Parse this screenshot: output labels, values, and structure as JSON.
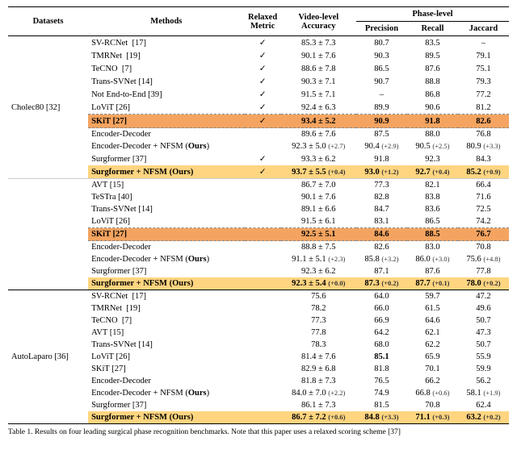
{
  "table": {
    "caption": "Table 1. Results on four leading surgical phase recognition benchmarks. Note that this paper uses a relaxed scoring scheme [37]",
    "col_headers": {
      "datasets": "Datasets",
      "methods": "Methods",
      "relaxed_metric": "Relaxed Metric",
      "video_accuracy": "Video-level Accuracy",
      "phase_precision": "Precision",
      "phase_recall": "Recall",
      "phase_jaccard": "Jaccard",
      "phase_group": "Phase-level"
    },
    "cholec80_rows": [
      {
        "method": "SV-RCNet  [17]",
        "relaxed": true,
        "video_acc": "85.3 ± 7.3",
        "precision": "80.7",
        "recall": "83.5",
        "jaccard": "–"
      },
      {
        "method": "TMRNet  [19]",
        "relaxed": true,
        "video_acc": "90.1 ± 7.6",
        "precision": "90.3",
        "recall": "89.5",
        "jaccard": "79.1"
      },
      {
        "method": "TeCNO  [7]",
        "relaxed": true,
        "video_acc": "88.6 ± 7.8",
        "precision": "86.5",
        "recall": "87.6",
        "jaccard": "75.1"
      },
      {
        "method": "Trans-SVNet [14]",
        "relaxed": true,
        "video_acc": "90.3 ± 7.1",
        "precision": "90.7",
        "recall": "88.8",
        "jaccard": "79.3"
      },
      {
        "method": "Not End-to-End [39]",
        "relaxed": true,
        "video_acc": "91.5 ± 7.1",
        "precision": "–",
        "recall": "86.8",
        "jaccard": "77.2"
      },
      {
        "method": "LoViT [26]",
        "relaxed": true,
        "video_acc": "92.4 ± 6.3",
        "precision": "89.9",
        "recall": "90.6",
        "jaccard": "81.2"
      },
      {
        "method": "SKiT [27]",
        "relaxed": true,
        "video_acc": "93.4 ± 5.2",
        "precision": "90.9",
        "recall": "91.8",
        "jaccard": "82.6",
        "highlight_row": "orange",
        "dashed_top": true
      },
      {
        "method": "Encoder-Decoder",
        "relaxed": false,
        "video_acc": "89.6 ± 7.6",
        "precision": "87.5",
        "recall": "88.0",
        "jaccard": "76.8",
        "dashed_top": true
      },
      {
        "method": "Encoder-Decoder + NFSM (Ours)",
        "relaxed": false,
        "video_acc": "92.3 ± 5.0",
        "video_acc_delta": "(+2.7)",
        "precision": "90.4",
        "precision_delta": "(+2.9)",
        "recall": "90.5",
        "recall_delta": "(+2.5)",
        "jaccard": "80.9",
        "jaccard_delta": "(+3.3)"
      },
      {
        "method": "Surgformer [37]",
        "relaxed": true,
        "video_acc": "93.3 ± 6.2",
        "precision": "91.8",
        "recall": "92.3",
        "jaccard": "84.3"
      },
      {
        "method": "Surgformer + NFSM (Ours)",
        "relaxed": true,
        "video_acc": "93.7 ± 5.5",
        "video_acc_delta": "(+0.4)",
        "precision": "93.0",
        "precision_delta": "(+1.2)",
        "recall": "92.7",
        "recall_delta": "(+0.4)",
        "jaccard": "85.2",
        "jaccard_delta": "(+0.9)",
        "highlight_row": "yellow",
        "bold": true
      }
    ],
    "cholec80_label": "Cholec80 [32]",
    "avt_rows": [
      {
        "method": "AVT [15]",
        "relaxed": false,
        "video_acc": "86.7 ± 7.0",
        "precision": "77.3",
        "recall": "82.1",
        "jaccard": "66.4"
      },
      {
        "method": "TeSTra [40]",
        "relaxed": false,
        "video_acc": "90.1 ± 7.6",
        "precision": "82.8",
        "recall": "83.8",
        "jaccard": "71.6"
      },
      {
        "method": "Trans-SVNet [14]",
        "relaxed": false,
        "video_acc": "89.1 ± 6.6",
        "precision": "84.7",
        "recall": "83.6",
        "jaccard": "72.5"
      },
      {
        "method": "LoViT [26]",
        "relaxed": false,
        "video_acc": "91.5 ± 6.1",
        "precision": "83.1",
        "recall": "86.5",
        "jaccard": "74.2"
      },
      {
        "method": "SKiT [27]",
        "relaxed": false,
        "video_acc": "92.5 ± 5.1",
        "precision": "84.6",
        "recall": "88.5",
        "jaccard": "76.7",
        "highlight_row": "orange",
        "dashed_top": true
      },
      {
        "method": "Encoder-Decoder",
        "relaxed": false,
        "video_acc": "88.8 ± 7.5",
        "precision": "82.6",
        "recall": "83.0",
        "jaccard": "70.8",
        "dashed_top": true
      },
      {
        "method": "Encoder-Decoder + NFSM (Ours)",
        "relaxed": false,
        "video_acc": "91.1 ± 5.1",
        "video_acc_delta": "(+2.3)",
        "precision": "85.8",
        "precision_delta": "(+3.2)",
        "recall": "86.0",
        "recall_delta": "(+3.0)",
        "jaccard": "75.6",
        "jaccard_delta": "(+4.8)"
      },
      {
        "method": "Surgformer [37]",
        "relaxed": false,
        "video_acc": "92.3 ± 6.2",
        "precision": "87.1",
        "recall": "87.6",
        "jaccard": "77.8"
      },
      {
        "method": "Surgformer + NFSM (Ours)",
        "relaxed": false,
        "video_acc": "92.3 ± 5.4",
        "video_acc_delta": "(+0.0)",
        "precision": "87.3",
        "precision_delta": "(+0.2)",
        "recall": "87.7",
        "recall_delta": "(+0.1)",
        "jaccard": "78.0",
        "jaccard_delta": "(+0.2)",
        "highlight_row": "yellow",
        "bold": true
      }
    ],
    "autolaparo_rows": [
      {
        "method": "SV-RCNet  [17]",
        "relaxed": false,
        "video_acc": "75.6",
        "precision": "64.0",
        "recall": "59.7",
        "jaccard": "47.2"
      },
      {
        "method": "TMRNet  [19]",
        "relaxed": false,
        "video_acc": "78.2",
        "precision": "66.0",
        "recall": "61.5",
        "jaccard": "49.6"
      },
      {
        "method": "TeCNO  [7]",
        "relaxed": false,
        "video_acc": "77.3",
        "precision": "66.9",
        "recall": "64.6",
        "jaccard": "50.7"
      },
      {
        "method": "AVT [15]",
        "relaxed": false,
        "video_acc": "77.8",
        "precision": "64.2",
        "recall": "62.1",
        "jaccard": "47.3"
      },
      {
        "method": "Trans-SVNet [14]",
        "relaxed": false,
        "video_acc": "78.3",
        "precision": "68.0",
        "recall": "62.2",
        "jaccard": "50.7"
      },
      {
        "method": "LoViT [26]",
        "relaxed": false,
        "video_acc": "81.4 ± 7.6",
        "precision": "85.1",
        "recall": "65.9",
        "jaccard": "55.9"
      },
      {
        "method": "SKiT [27]",
        "relaxed": false,
        "video_acc": "82.9 ± 6.8",
        "precision": "81.8",
        "recall": "70.1",
        "jaccard": "59.9"
      },
      {
        "method": "Encoder-Decoder",
        "relaxed": false,
        "video_acc": "81.8 ± 7.3",
        "precision": "76.5",
        "recall": "66.2",
        "jaccard": "56.2"
      },
      {
        "method": "Encoder-Decoder + NFSM (Ours)",
        "relaxed": false,
        "video_acc": "84.0 ± 7.0",
        "video_acc_delta": "(+2.2)",
        "precision": "74.9",
        "recall": "66.8",
        "recall_delta": "(+0.6)",
        "jaccard": "58.1",
        "jaccard_delta": "(+1.9)"
      },
      {
        "method": "Surgformer [37]",
        "relaxed": false,
        "video_acc": "86.1 ± 7.3",
        "precision": "81.5",
        "recall": "70.8",
        "jaccard": "62.4"
      },
      {
        "method": "Surgformer + NFSM (Ours)",
        "relaxed": false,
        "video_acc": "86.7 ± 7.2",
        "video_acc_delta": "(+0.6)",
        "precision": "84.8",
        "precision_delta": "(+3.3)",
        "recall": "71.1",
        "recall_delta": "(+0.3)",
        "jaccard": "63.2",
        "jaccard_delta": "(+0.2)",
        "highlight_row": "yellow",
        "bold": true
      }
    ],
    "autolaparo_label": "AutoLaparo [36]"
  }
}
